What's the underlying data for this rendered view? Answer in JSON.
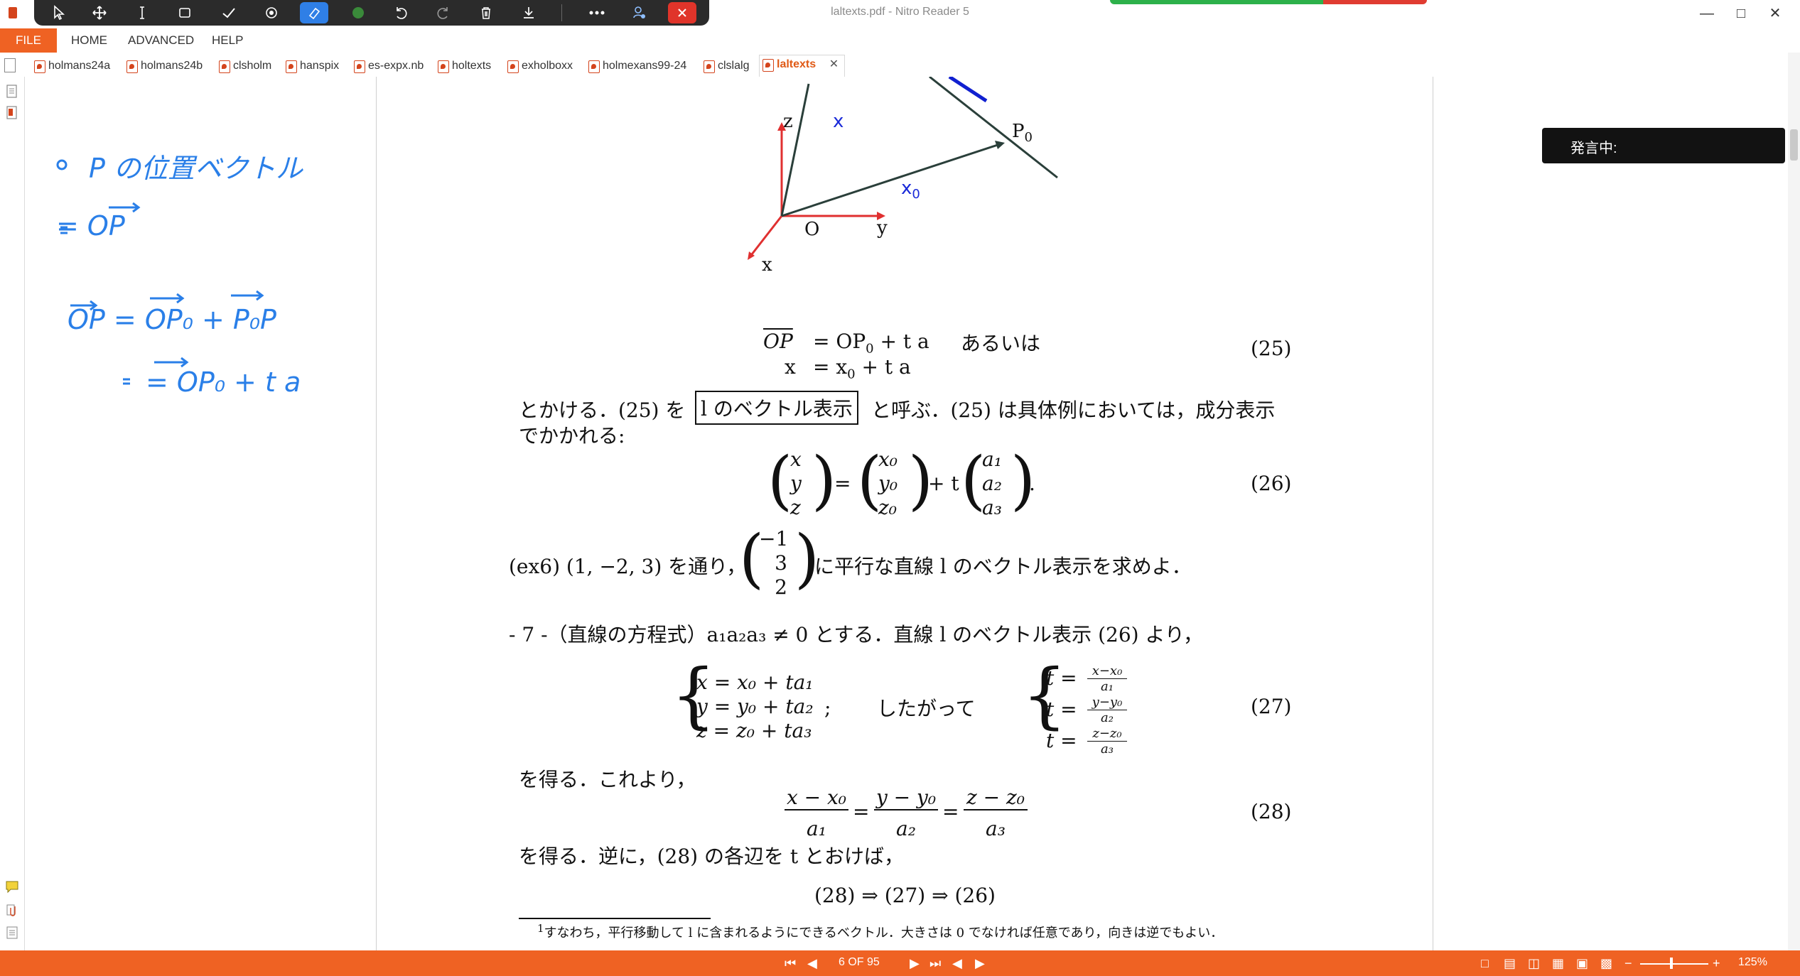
{
  "window": {
    "title": "laltexts.pdf - Nitro Reader 5",
    "minimize_icon": "minimize-icon",
    "maximize_icon": "maximize-icon",
    "close_icon": "close-icon"
  },
  "toolbar": {
    "tools": [
      "select-arrow-icon",
      "pan-icon",
      "text-cursor-icon",
      "rectangle-icon",
      "checkmark-icon",
      "lasso-icon",
      "eraser-icon",
      "color-dot-icon",
      "undo-icon",
      "redo-icon",
      "trash-icon",
      "download-icon",
      "more-icon",
      "user-settings-icon",
      "close-icon"
    ],
    "accent": "#2f7fe6",
    "pen_color": "#3a8a3a"
  },
  "menu": {
    "file": "FILE",
    "home": "HOME",
    "advanced": "ADVANCED",
    "help": "HELP"
  },
  "tabs": [
    {
      "label": "holmans24a"
    },
    {
      "label": "holmans24b"
    },
    {
      "label": "clsholm"
    },
    {
      "label": "hanspix"
    },
    {
      "label": "es-expx.nb"
    },
    {
      "label": "holtexts"
    },
    {
      "label": "exholboxx"
    },
    {
      "label": "holmexans99-24"
    },
    {
      "label": "clslalg"
    },
    {
      "label": "laltexts",
      "active": true
    }
  ],
  "caption_panel": {
    "label": "発言中:"
  },
  "status": {
    "page_indicator": "6 OF 95",
    "zoom": "125%",
    "brand_color": "#ef6223"
  },
  "handwritten_notes": {
    "line1": "P の位置ベクトル",
    "line2": "= OP",
    "line3": "OP = OP₀ + P₀P",
    "line4": "= OP₀ + t a"
  },
  "document": {
    "figure": {
      "labels": {
        "z": "z",
        "x_vec": "x",
        "p0": "P",
        "p0_sub": "0",
        "x0": "x",
        "x0_sub": "0",
        "o": "O",
        "y": "y",
        "x_axis": "x"
      }
    },
    "eq25": {
      "line1_lhs": "OP",
      "line1_rhs": "= OP",
      "line1_sub": "0",
      "line1_tail": " + t a",
      "aruiwa": "あるいは",
      "line2_lhs": "x",
      "line2_rhs": "= x",
      "line2_sub": "0",
      "line2_tail": " + t a",
      "number": "(25)"
    },
    "para1_a": "とかける．(25) を",
    "boxed": "l のベクトル表示",
    "para1_b": "と呼ぶ．(25) は具体例においては，成分表示",
    "para1_c": "でかかれる:",
    "eq26": {
      "vec1": [
        "x",
        "y",
        "z"
      ],
      "vec2": [
        "x₀",
        "y₀",
        "z₀"
      ],
      "vec3": [
        "a₁",
        "a₂",
        "a₃"
      ],
      "eq": "=",
      "plus_t": "+ t",
      "period": ".",
      "number": "(26)"
    },
    "ex6": {
      "lead": "(ex6) (1, −2, 3) を通り，",
      "vec": [
        "−1",
        "3",
        "2"
      ],
      "tail": "に平行な直線 l のベクトル表示を求めよ．"
    },
    "section7": "- 7 -（直線の方程式）a₁a₂a₃ ≠ 0 とする．直線 l のベクトル表示 (26) より，",
    "eq27": {
      "left": [
        "x = x₀ + ta₁",
        "y = y₀ + ta₂",
        "z = z₀ + ta₃"
      ],
      "semicolon": ";",
      "middle": "したがって",
      "right_t": [
        "t =",
        "t =",
        "t ="
      ],
      "right_num": [
        "x−x₀",
        "y−y₀",
        "z−z₀"
      ],
      "right_den": [
        "a₁",
        "a₂",
        "a₃"
      ],
      "number": "(27)"
    },
    "para2": "を得る．これより，",
    "eq28": {
      "num": [
        "x − x₀",
        "y − y₀",
        "z − z₀"
      ],
      "den": [
        "a₁",
        "a₂",
        "a₃"
      ],
      "eq": "=",
      "number": "(28)"
    },
    "para3": "を得る．逆に，(28) の各辺を t とおけば，",
    "implication": "(28) ⇒ (27) ⇒ (26)",
    "footnote_mark": "1",
    "footnote": "すなわち，平行移動して l に含まれるようにできるベクトル．大きさは 0 でなければ任意であり，向きは逆でもよい．"
  }
}
